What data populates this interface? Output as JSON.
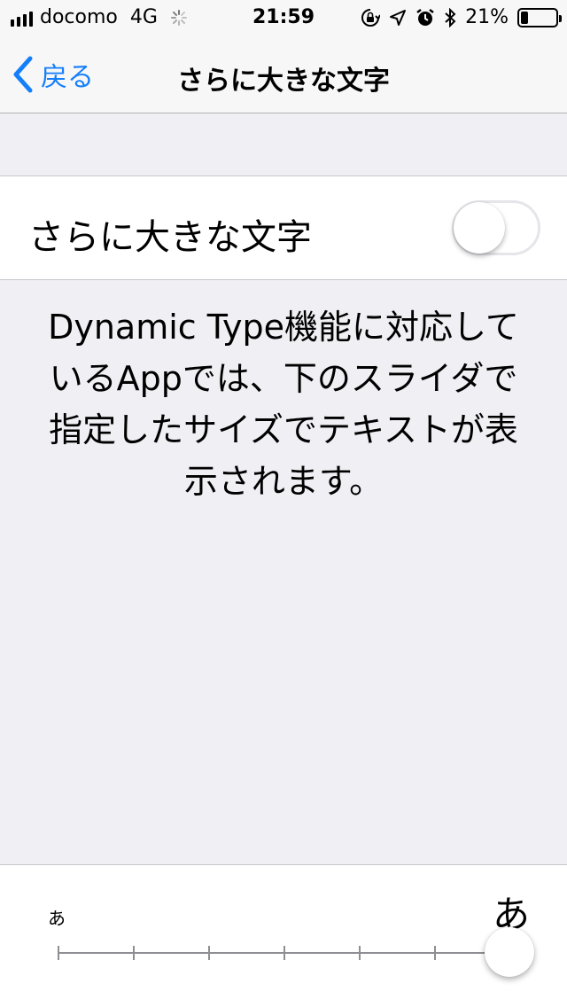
{
  "status_bar": {
    "carrier": "docomo",
    "network": "4G",
    "time": "21:59",
    "battery": "21%",
    "battery_level": 0.21,
    "icons": [
      "signal-bars-icon",
      "activity-spinner-icon",
      "orientation-lock-icon",
      "location-arrow-icon",
      "alarm-clock-icon",
      "bluetooth-icon",
      "battery-icon"
    ]
  },
  "nav": {
    "back_label": "戻る",
    "title": "さらに大きな文字"
  },
  "toggle_cell": {
    "label": "さらに大きな文字",
    "on": false
  },
  "description": "Dynamic Type機能に対応しているAppでは、下のスライダで指定したサイズでテキストが表示されます。",
  "slider": {
    "min_label": "あ",
    "max_label": "あ",
    "steps": 7,
    "value_index": 6
  },
  "colors": {
    "accent": "#147efb",
    "background": "#efeff4",
    "separator": "#c8c7cc"
  }
}
